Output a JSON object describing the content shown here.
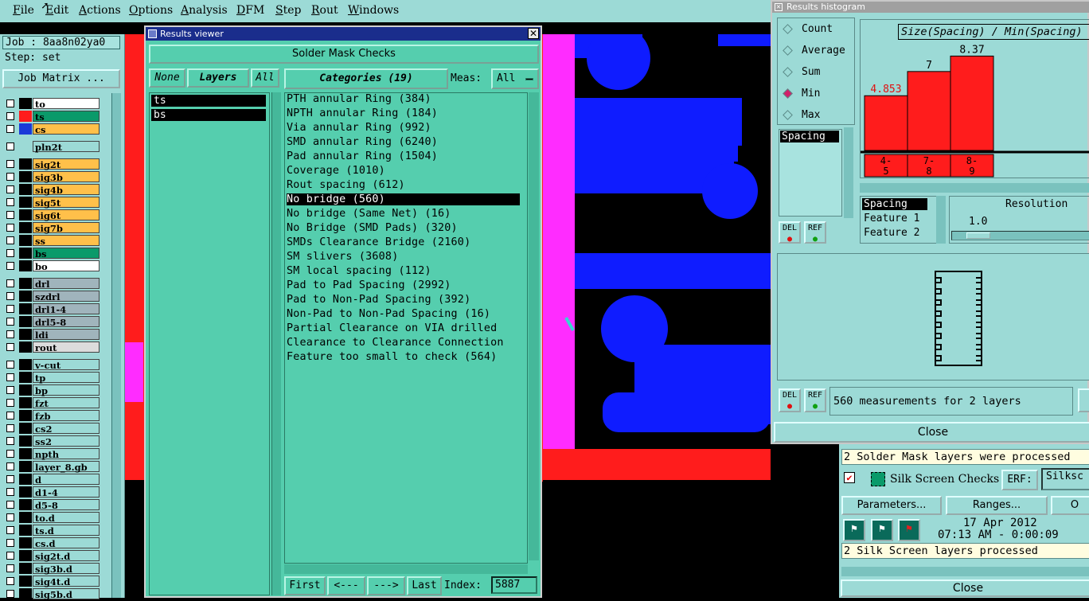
{
  "menubar": {
    "items": [
      "File",
      "Edit",
      "Actions",
      "Options",
      "Analysis",
      "DFM",
      "Step",
      "Rout",
      "Windows"
    ]
  },
  "left": {
    "job": "Job : 8aa8n02ya0",
    "step": "Step: set",
    "job_matrix": "Job Matrix ...",
    "layers": [
      {
        "name": "to",
        "color": "#ffffff",
        "ind": "#000000"
      },
      {
        "name": "ts",
        "color": "#0a9a6a",
        "ind": "#ff1c1c"
      },
      {
        "name": "cs",
        "color": "#ffc04a",
        "ind": "#1a3ad8"
      },
      {
        "name": "pln2t",
        "color": "#9cdad6",
        "ind": ""
      },
      {
        "name": "sig2t",
        "color": "#ffc04a",
        "ind": "#000000"
      },
      {
        "name": "sig3b",
        "color": "#ffc04a",
        "ind": "#000000"
      },
      {
        "name": "sig4b",
        "color": "#ffc04a",
        "ind": "#000000"
      },
      {
        "name": "sig5t",
        "color": "#ffc04a",
        "ind": "#000000"
      },
      {
        "name": "sig6t",
        "color": "#ffc04a",
        "ind": "#000000"
      },
      {
        "name": "sig7b",
        "color": "#ffc04a",
        "ind": "#000000"
      },
      {
        "name": "ss",
        "color": "#ffc04a",
        "ind": "#000000"
      },
      {
        "name": "bs",
        "color": "#0a9a6a",
        "ind": "#000000"
      },
      {
        "name": "bo",
        "color": "#ffffff",
        "ind": "#000000"
      },
      {
        "name": "drl",
        "color": "#a0b4bc",
        "ind": "#000000"
      },
      {
        "name": "szdrl",
        "color": "#a0b4bc",
        "ind": "#000000"
      },
      {
        "name": "drl1-4",
        "color": "#a0b4bc",
        "ind": "#000000"
      },
      {
        "name": "drl5-8",
        "color": "#a0b4bc",
        "ind": "#000000"
      },
      {
        "name": "ldi",
        "color": "#a0b4bc",
        "ind": "#000000"
      },
      {
        "name": "rout",
        "color": "#dcdcdc",
        "ind": "#000000"
      },
      {
        "name": "v-cut",
        "color": "#9cdad6",
        "ind": "#000000"
      },
      {
        "name": "tp",
        "color": "#9cdad6",
        "ind": "#000000"
      },
      {
        "name": "bp",
        "color": "#9cdad6",
        "ind": "#000000"
      },
      {
        "name": "fzt",
        "color": "#9cdad6",
        "ind": "#000000"
      },
      {
        "name": "fzb",
        "color": "#9cdad6",
        "ind": "#000000"
      },
      {
        "name": "cs2",
        "color": "#9cdad6",
        "ind": "#000000"
      },
      {
        "name": "ss2",
        "color": "#9cdad6",
        "ind": "#000000"
      },
      {
        "name": "npth",
        "color": "#9cdad6",
        "ind": "#000000"
      },
      {
        "name": "layer_8.gb",
        "color": "#9cdad6",
        "ind": "#000000"
      },
      {
        "name": "d",
        "color": "#9cdad6",
        "ind": "#000000"
      },
      {
        "name": "d1-4",
        "color": "#9cdad6",
        "ind": "#000000"
      },
      {
        "name": "d5-8",
        "color": "#9cdad6",
        "ind": "#000000"
      },
      {
        "name": "to.d",
        "color": "#9cdad6",
        "ind": "#000000"
      },
      {
        "name": "ts.d",
        "color": "#9cdad6",
        "ind": "#000000"
      },
      {
        "name": "cs.d",
        "color": "#9cdad6",
        "ind": "#000000"
      },
      {
        "name": "sig2t.d",
        "color": "#9cdad6",
        "ind": "#000000"
      },
      {
        "name": "sig3b.d",
        "color": "#9cdad6",
        "ind": "#000000"
      },
      {
        "name": "sig4t.d",
        "color": "#9cdad6",
        "ind": "#000000"
      },
      {
        "name": "sig5b.d",
        "color": "#9cdad6",
        "ind": "#000000"
      }
    ]
  },
  "results_viewer": {
    "title": "Results viewer",
    "header": "Solder Mask Checks",
    "none_btn": "None",
    "layers_btn": "Layers",
    "all_btn": "All",
    "layers": [
      "ts",
      "bs"
    ],
    "categories_btn": "Categories (19)",
    "meas_label": "Meas:",
    "meas_value": "All",
    "categories": [
      "PTH annular Ring (384)",
      "NPTH annular Ring (184)",
      "Via annular Ring (992)",
      "SMD annular Ring (6240)",
      "Pad annular Ring (1504)",
      "Coverage (1010)",
      "Rout spacing (612)",
      "No bridge (560)",
      "No bridge (Same Net) (16)",
      "No Bridge (SMD Pads) (320)",
      "SMDs Clearance Bridge (2160)",
      "SM slivers (3608)",
      "SM local spacing (112)",
      "Pad to Pad Spacing (2992)",
      "Pad to Non-Pad Spacing (392)",
      "Non-Pad to Non-Pad Spacing (16)",
      "Partial Clearance on VIA drilled",
      "Clearance to Clearance Connection",
      "Feature too small to check (564)"
    ],
    "selected_index": 7,
    "first_btn": "First",
    "prev_btn": "<---",
    "next_btn": "--->",
    "last_btn": "Last",
    "index_label": "Index:",
    "index_value": "5887"
  },
  "histogram": {
    "title": "Results histogram",
    "modes": [
      "Count",
      "Average",
      "Sum",
      "Min",
      "Max"
    ],
    "selected_mode": "Min",
    "metric_list": [
      "Spacing"
    ],
    "chart_title": "Size(Spacing) / Min(Spacing)",
    "bars": [
      {
        "label": "4.853",
        "range_top": "4-",
        "range_bot": "5",
        "value": 4.853
      },
      {
        "label": "7",
        "range_top": "7-",
        "range_bot": "8",
        "value": 7
      },
      {
        "label": "8.37",
        "range_top": "8-",
        "range_bot": "9",
        "value": 8.37
      }
    ],
    "y_max": 9,
    "sort_list": [
      "Spacing",
      "Feature 1",
      "Feature 2"
    ],
    "resolution_label": "Resolution",
    "resolution_value": "1.0",
    "del_btn": "DEL",
    "ref_btn": "REF",
    "measurements": "560 measurements for 2 layers",
    "close_btn": "Close"
  },
  "erp": {
    "line1": "2 Solder Mask layers were processed",
    "silk_title": "Silk Screen Checks",
    "erf_label": "ERF:",
    "erf_value": "Silksc",
    "params_btn": "Parameters...",
    "ranges_btn": "Ranges...",
    "other_btn": "O",
    "date": "17 Apr 2012",
    "time": "07:13 AM - 0:00:09",
    "line2": "2 Silk Screen layers processed",
    "close_btn": "Close"
  }
}
